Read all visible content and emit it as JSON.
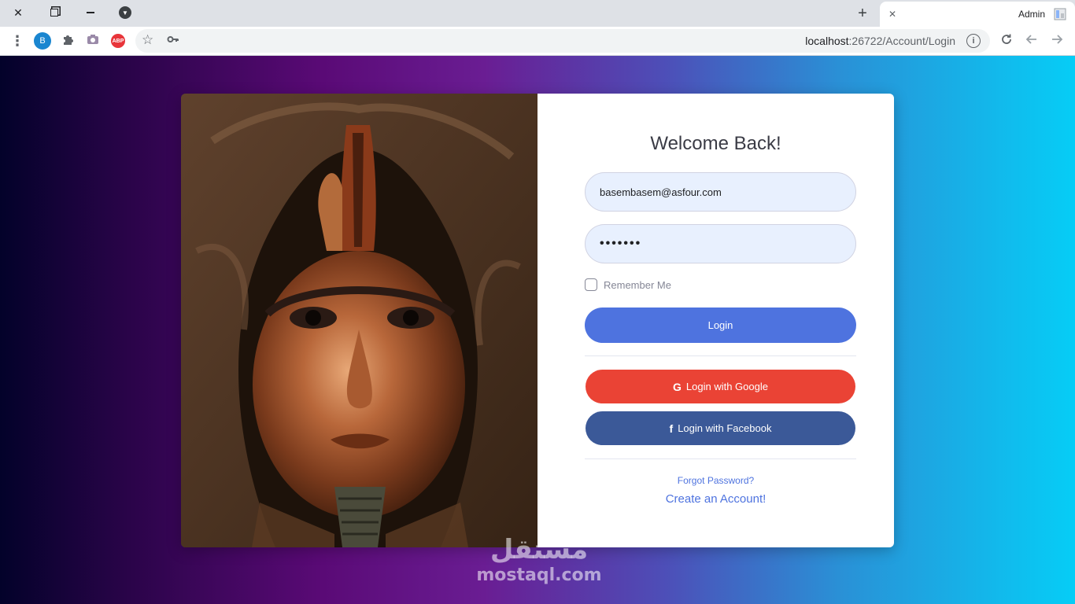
{
  "browser": {
    "tab_title": "Admin",
    "url_host": "localhost",
    "url_path": ":26722/Account/Login",
    "extension_b_label": "B",
    "extension_abp_label": "ABP",
    "icons": {
      "close_window": "close-icon",
      "restore_window": "restore-icon",
      "minimize_window": "minimize-icon",
      "tab_search": "dropdown-icon",
      "new_tab": "plus-icon",
      "tab_close": "close-icon",
      "reload": "reload-icon",
      "back": "arrow-left-icon",
      "forward": "arrow-right-icon",
      "menu": "kebab-icon",
      "star": "star-icon",
      "key": "key-icon",
      "info": "info-icon"
    }
  },
  "login": {
    "heading": "Welcome Back!",
    "email_value": "basembasem@asfour.com",
    "password_value": "•••••••",
    "remember_label": "Remember Me",
    "login_label": "Login",
    "google_label": "Login with Google",
    "facebook_label": "Login with Facebook",
    "forgot_label": "Forgot Password?",
    "create_label": "Create an Account!"
  },
  "watermark": {
    "arabic": "مستقل",
    "latin": "mostaql.com"
  },
  "colors": {
    "primary": "#4e73df",
    "google": "#ea4335",
    "facebook": "#3b5998"
  }
}
